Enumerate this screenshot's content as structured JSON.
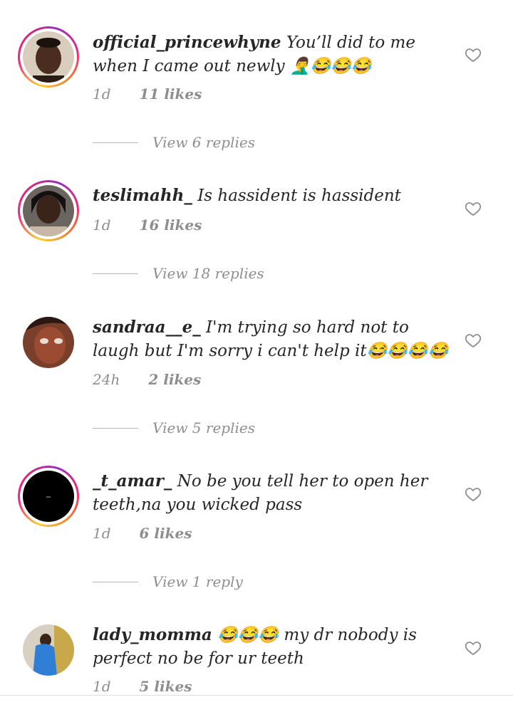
{
  "comments": [
    {
      "username": "official_princewhyne",
      "text": "You’ll did to me when I came out newly 🤦‍♂😂😂😂",
      "time": "1d",
      "likes": "11 likes",
      "replies": "View 6 replies",
      "has_story": true,
      "avatar_icon": "avatar-photo-icon"
    },
    {
      "username": "teslimahh_",
      "text": "Is hassident is hassident",
      "time": "1d",
      "likes": "16 likes",
      "replies": "View 18 replies",
      "has_story": true,
      "avatar_icon": "avatar-photo-icon"
    },
    {
      "username": "sandraa__e_",
      "text": "I'm trying so hard not to laugh but I'm sorry i can't help it😂😂😂😂",
      "time": "24h",
      "likes": "2 likes",
      "replies": "View 5 replies",
      "has_story": false,
      "avatar_icon": "avatar-photo-icon"
    },
    {
      "username": "_t_amar_",
      "text": "No be you tell her to open her teeth,na you wicked pass",
      "time": "1d",
      "likes": "6 likes",
      "replies": "View 1 reply",
      "has_story": true,
      "avatar_icon": "avatar-photo-icon"
    },
    {
      "username": "lady_momma",
      "text": "😂😂😂 my dr nobody is perfect no be for ur teeth",
      "time": "1d",
      "likes": "5 likes",
      "replies": "",
      "has_story": false,
      "avatar_icon": "avatar-photo-icon"
    }
  ],
  "icons": {
    "like": "heart-icon"
  },
  "colors": {
    "meta": "#8e8e8e",
    "text": "#262626"
  }
}
